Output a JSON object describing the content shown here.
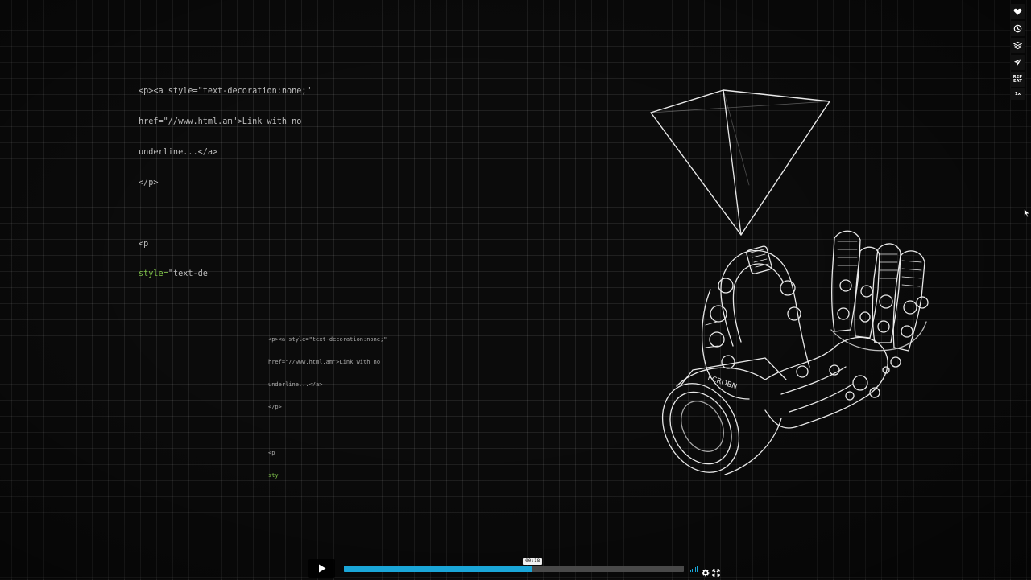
{
  "code_large": {
    "lines": [
      "<p><a style=\"text-decoration:none;\"",
      "href=\"//www.html.am\">Link with no",
      "underline...</a>",
      "</p>"
    ],
    "tag_open": "<p",
    "attr_partial": "style=\"text-de"
  },
  "code_small": {
    "lines": [
      "<p><a style=\"text-decoration:none;\"",
      "href=\"//www.html.am\">Link with no",
      "underline...</a>",
      "</p>"
    ],
    "tag_open": "<p",
    "attr_partial": "sty"
  },
  "side_tools": [
    {
      "name": "like-heart-icon"
    },
    {
      "name": "watch-later-clock-icon"
    },
    {
      "name": "collections-layers-icon"
    },
    {
      "name": "share-send-icon"
    },
    {
      "name": "repeat-button",
      "label_line1": "REP",
      "label_line2": "EAT"
    },
    {
      "name": "speed-button",
      "label": "1x"
    }
  ],
  "player": {
    "time_tooltip": "00:18",
    "progress_fraction": 0.555,
    "accent_color": "#1aa6d8",
    "icons": [
      "play-icon",
      "volume-icon",
      "settings-gear-icon",
      "fullscreen-icon"
    ]
  }
}
